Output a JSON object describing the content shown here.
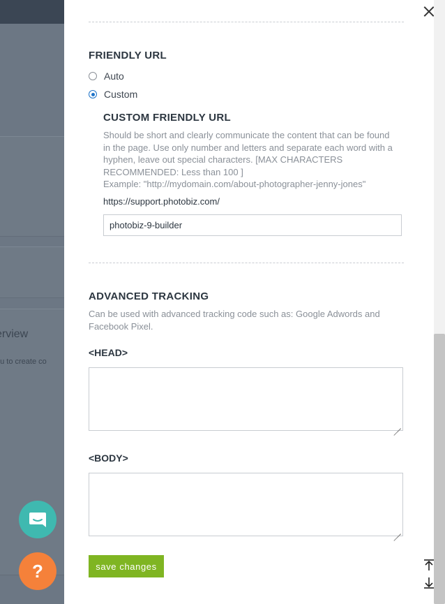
{
  "background": {
    "heading_fragment": "erview",
    "sub_fragment": "ou to create co"
  },
  "friendly_url": {
    "title": "FRIENDLY URL",
    "options": [
      {
        "label": "Auto",
        "checked": false
      },
      {
        "label": "Custom",
        "checked": true
      }
    ],
    "custom_title": "CUSTOM FRIENDLY URL",
    "help_lines": [
      "Should be short and clearly communicate the content that can be found",
      "in the page. Use only number and letters and separate each word with a",
      "hyphen, leave out special characters. [MAX CHARACTERS",
      "RECOMMENDED: Less than 100 ]",
      "Example: \"http://mydomain.com/about-photographer-jenny-jones\""
    ],
    "url_prefix": "https://support.photobiz.com/",
    "input_value": "photobiz-9-builder"
  },
  "advanced_tracking": {
    "title": "ADVANCED TRACKING",
    "description_lines": [
      "Can be used with advanced tracking code such as: Google Adwords and",
      "Facebook Pixel."
    ],
    "head_label": "<HEAD>",
    "body_label": "<BODY>",
    "head_value": "",
    "body_value": ""
  },
  "save_label": "save changes",
  "help_fab_label": "?",
  "icons": {
    "close": "close-icon",
    "chat": "chat-icon",
    "help": "help-icon",
    "scroll_top": "scroll-to-top-icon",
    "scroll_bottom": "scroll-to-bottom-icon"
  },
  "colors": {
    "accent_radio": "#1e73c8",
    "save_button": "#7fb522",
    "chat_fab": "#3fb9b0",
    "help_fab": "#f5813a"
  }
}
